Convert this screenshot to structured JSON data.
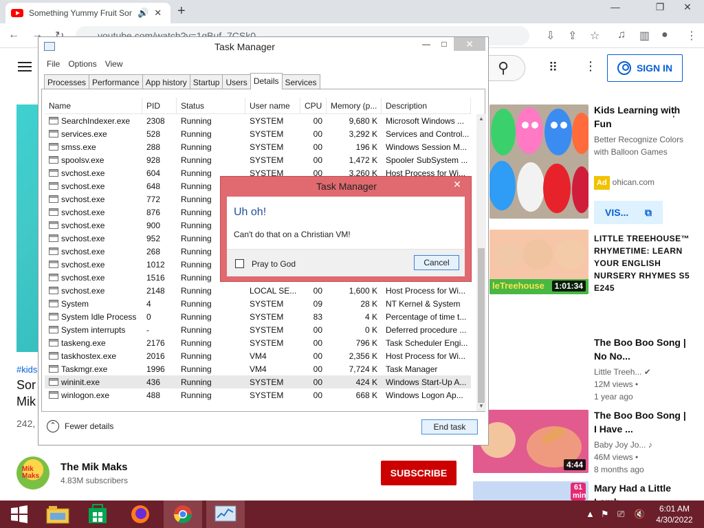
{
  "browser": {
    "tab_title": "Something Yummy Fruit Son",
    "url": "youtube.com/watch?v=1qBuf_7CSk0"
  },
  "youtube": {
    "signin_label": "SIGN IN",
    "hashtag": "#kids",
    "title_fragment": "Sor Mik",
    "views_fragment": "242,",
    "channel": {
      "name": "The Mik Maks",
      "subscribers": "4.83M subscribers",
      "avatar_text": "Mik Maks"
    },
    "subscribe_label": "SUBSCRIBE",
    "related": [
      {
        "title": "Kids Learning with Fun",
        "meta1": "Better Recognize Colors with Balloon Games",
        "ad_label": "Ad",
        "ad_site": "ohican.com",
        "visit_label": "VIS..."
      },
      {
        "title": "LITTLE TREEHOUSE™ RHYMETIME: LEARN YOUR ENGLISH NURSERY RHYMES S5 E245",
        "duration": "1:01:34",
        "thumb_text": "leTreehouse"
      },
      {
        "title": "The Boo Boo Song | No No...",
        "channel": "Little Treeh...",
        "views": "12M views •",
        "age": "1 year ago"
      },
      {
        "title": "The Boo Boo Song | I Have ...",
        "channel": "Baby Joy Jo...",
        "views": "46M views •",
        "age": "8 months ago",
        "duration": "4:44"
      },
      {
        "title": "Mary Had a Little Lamb...",
        "badge": "61 min"
      }
    ]
  },
  "taskmgr": {
    "title": "Task Manager",
    "menus": [
      "File",
      "Options",
      "View"
    ],
    "tabs": [
      "Processes",
      "Performance",
      "App history",
      "Startup",
      "Users",
      "Details",
      "Services"
    ],
    "active_tab": "Details",
    "columns": [
      "Name",
      "PID",
      "Status",
      "User name",
      "CPU",
      "Memory (p...",
      "Description"
    ],
    "rows": [
      [
        "SearchIndexer.exe",
        "2308",
        "Running",
        "SYSTEM",
        "00",
        "9,680 K",
        "Microsoft Windows ..."
      ],
      [
        "services.exe",
        "528",
        "Running",
        "SYSTEM",
        "00",
        "3,292 K",
        "Services and Control..."
      ],
      [
        "smss.exe",
        "288",
        "Running",
        "SYSTEM",
        "00",
        "196 K",
        "Windows Session M..."
      ],
      [
        "spoolsv.exe",
        "928",
        "Running",
        "SYSTEM",
        "00",
        "1,472 K",
        "Spooler SubSystem ..."
      ],
      [
        "svchost.exe",
        "604",
        "Running",
        "SYSTEM",
        "00",
        "3,260 K",
        "Host Process for Wi..."
      ],
      [
        "svchost.exe",
        "648",
        "Running",
        "",
        "",
        "",
        ""
      ],
      [
        "svchost.exe",
        "772",
        "Running",
        "",
        "",
        "",
        ""
      ],
      [
        "svchost.exe",
        "876",
        "Running",
        "",
        "",
        "",
        ""
      ],
      [
        "svchost.exe",
        "900",
        "Running",
        "",
        "",
        "",
        ""
      ],
      [
        "svchost.exe",
        "952",
        "Running",
        "",
        "",
        "",
        ""
      ],
      [
        "svchost.exe",
        "268",
        "Running",
        "",
        "",
        "",
        ""
      ],
      [
        "svchost.exe",
        "1012",
        "Running",
        "",
        "",
        "",
        ""
      ],
      [
        "svchost.exe",
        "1516",
        "Running",
        "",
        "",
        "",
        ""
      ],
      [
        "svchost.exe",
        "2148",
        "Running",
        "LOCAL SE...",
        "00",
        "1,600 K",
        "Host Process for Wi..."
      ],
      [
        "System",
        "4",
        "Running",
        "SYSTEM",
        "09",
        "28 K",
        "NT Kernel & System"
      ],
      [
        "System Idle Process",
        "0",
        "Running",
        "SYSTEM",
        "83",
        "4 K",
        "Percentage of time t..."
      ],
      [
        "System interrupts",
        "-",
        "Running",
        "SYSTEM",
        "00",
        "0 K",
        "Deferred procedure ..."
      ],
      [
        "taskeng.exe",
        "2176",
        "Running",
        "SYSTEM",
        "00",
        "796 K",
        "Task Scheduler Engi..."
      ],
      [
        "taskhostex.exe",
        "2016",
        "Running",
        "VM4",
        "00",
        "2,356 K",
        "Host Process for Wi..."
      ],
      [
        "Taskmgr.exe",
        "1996",
        "Running",
        "VM4",
        "00",
        "7,724 K",
        "Task Manager"
      ],
      [
        "wininit.exe",
        "436",
        "Running",
        "SYSTEM",
        "00",
        "424 K",
        "Windows Start-Up A..."
      ],
      [
        "winlogon.exe",
        "488",
        "Running",
        "SYSTEM",
        "00",
        "668 K",
        "Windows Logon Ap..."
      ]
    ],
    "selected_row": 20,
    "fewer_details": "Fewer details",
    "end_task": "End task"
  },
  "dialog": {
    "title": "Task Manager",
    "heading": "Uh oh!",
    "message": "Can't do that on a Christian VM!",
    "checkbox_label": "Pray to God",
    "cancel_label": "Cancel"
  },
  "taskbar": {
    "time": "6:01 AM",
    "date": "4/30/2022"
  },
  "colors": {
    "taskbar": "#6b1f2a",
    "dialog_frame": "#e06a6f",
    "youtube_red": "#cc0000",
    "link_blue": "#065fd4"
  }
}
